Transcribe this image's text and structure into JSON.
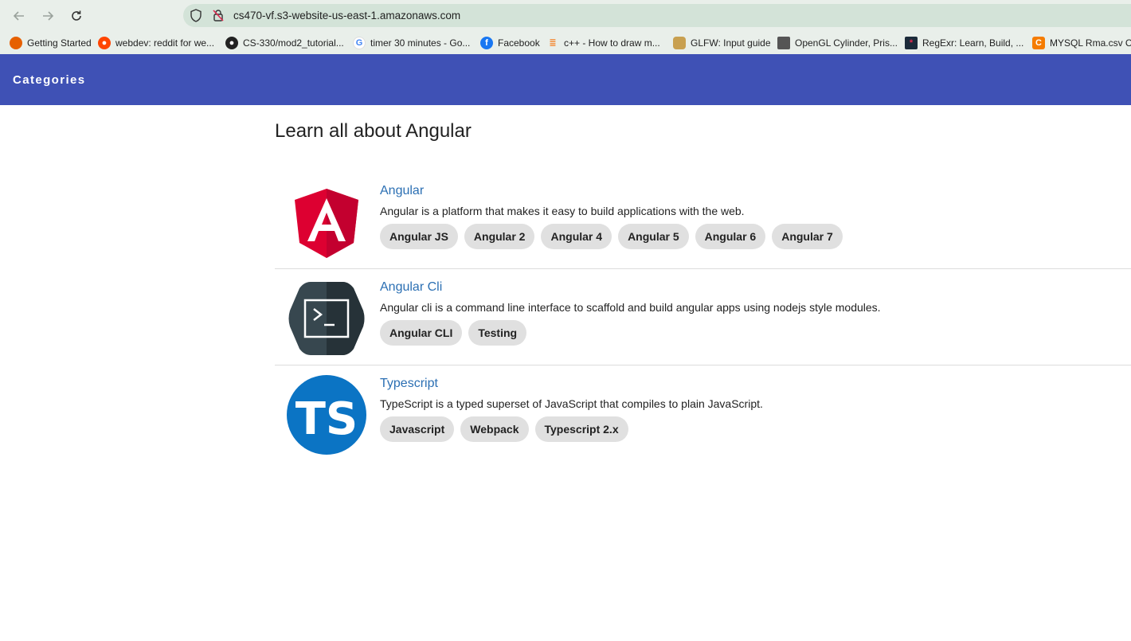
{
  "browser": {
    "url": "cs470-vf.s3-website-us-east-1.amazonaws.com",
    "bookmarks": [
      {
        "label": "Getting Started",
        "icon": "firefox-icon",
        "color": "#e66000"
      },
      {
        "label": "webdev: reddit for we...",
        "icon": "reddit-icon",
        "color": "#ff4500"
      },
      {
        "label": "CS-330/mod2_tutorial...",
        "icon": "github-icon",
        "color": "#222222"
      },
      {
        "label": "timer 30 minutes - Go...",
        "icon": "google-icon",
        "color": "#4285f4"
      },
      {
        "label": "Facebook",
        "icon": "facebook-icon",
        "color": "#1877f2"
      },
      {
        "label": "c++ - How to draw m...",
        "icon": "stackoverflow-icon",
        "color": "#f48024"
      },
      {
        "label": "GLFW: Input guide",
        "icon": "glfw-icon",
        "color": "#c8a050"
      },
      {
        "label": "OpenGL Cylinder, Pris...",
        "icon": "songho-icon",
        "color": "#555555"
      },
      {
        "label": "RegExr: Learn, Build, ...",
        "icon": "regexr-icon",
        "color": "#1c2b3a"
      },
      {
        "label": "MYSQL Rma.csv Cu",
        "icon": "c-icon",
        "color": "#f57c00"
      }
    ]
  },
  "appbar": {
    "title": "Categories",
    "color": "#3f51b5"
  },
  "main": {
    "title": "Learn all about Angular",
    "courses": [
      {
        "title": "Angular",
        "description": "Angular is a platform that makes it easy to build applications with the web.",
        "logo": "angular-logo",
        "tags": [
          "Angular JS",
          "Angular 2",
          "Angular 4",
          "Angular 5",
          "Angular 6",
          "Angular 7"
        ]
      },
      {
        "title": "Angular Cli",
        "description": "Angular cli is a command line interface to scaffold and build angular apps using nodejs style modules.",
        "logo": "angular-cli-logo",
        "tags": [
          "Angular CLI",
          "Testing"
        ]
      },
      {
        "title": "Typescript",
        "description": "TypeScript is a typed superset of JavaScript that compiles to plain JavaScript.",
        "logo": "typescript-logo",
        "logo_text": "TS",
        "tags": [
          "Javascript",
          "Webpack",
          "Typescript 2.x"
        ]
      }
    ]
  }
}
